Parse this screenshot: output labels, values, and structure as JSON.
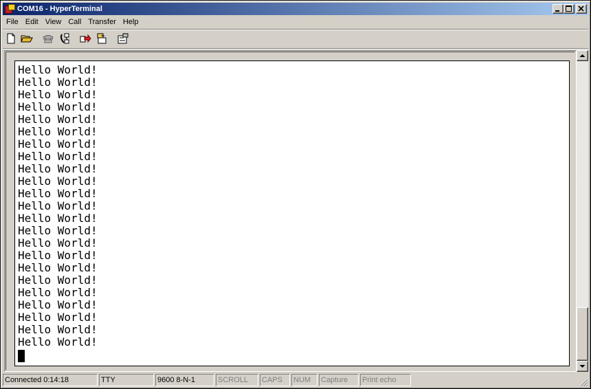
{
  "window": {
    "title": "COM16 - HyperTerminal",
    "caption_buttons": {
      "minimize": "_",
      "maximize": "□",
      "close": "✕"
    }
  },
  "menu": [
    {
      "label": "File"
    },
    {
      "label": "Edit"
    },
    {
      "label": "View"
    },
    {
      "label": "Call"
    },
    {
      "label": "Transfer"
    },
    {
      "label": "Help"
    }
  ],
  "toolbar": [
    {
      "name": "new-icon"
    },
    {
      "name": "open-icon"
    },
    {
      "name": "dial-icon"
    },
    {
      "name": "disconnect-icon"
    },
    {
      "name": "send-icon"
    },
    {
      "name": "receive-icon"
    },
    {
      "name": "properties-icon"
    }
  ],
  "terminal": {
    "lines": [
      "Hello World!",
      "Hello World!",
      "Hello World!",
      "Hello World!",
      "Hello World!",
      "Hello World!",
      "Hello World!",
      "Hello World!",
      "Hello World!",
      "Hello World!",
      "Hello World!",
      "Hello World!",
      "Hello World!",
      "Hello World!",
      "Hello World!",
      "Hello World!",
      "Hello World!",
      "Hello World!",
      "Hello World!",
      "Hello World!",
      "Hello World!",
      "Hello World!",
      "Hello World!"
    ]
  },
  "status": {
    "connected": "Connected 0:14:18",
    "emulation": "TTY",
    "port_settings": "9600 8-N-1",
    "scroll": "SCROLL",
    "caps": "CAPS",
    "num": "NUM",
    "capture": "Capture",
    "print_echo": "Print echo"
  },
  "colors": {
    "title_start": "#0a246a",
    "title_end": "#a6caf0",
    "face": "#d4d0c8"
  }
}
